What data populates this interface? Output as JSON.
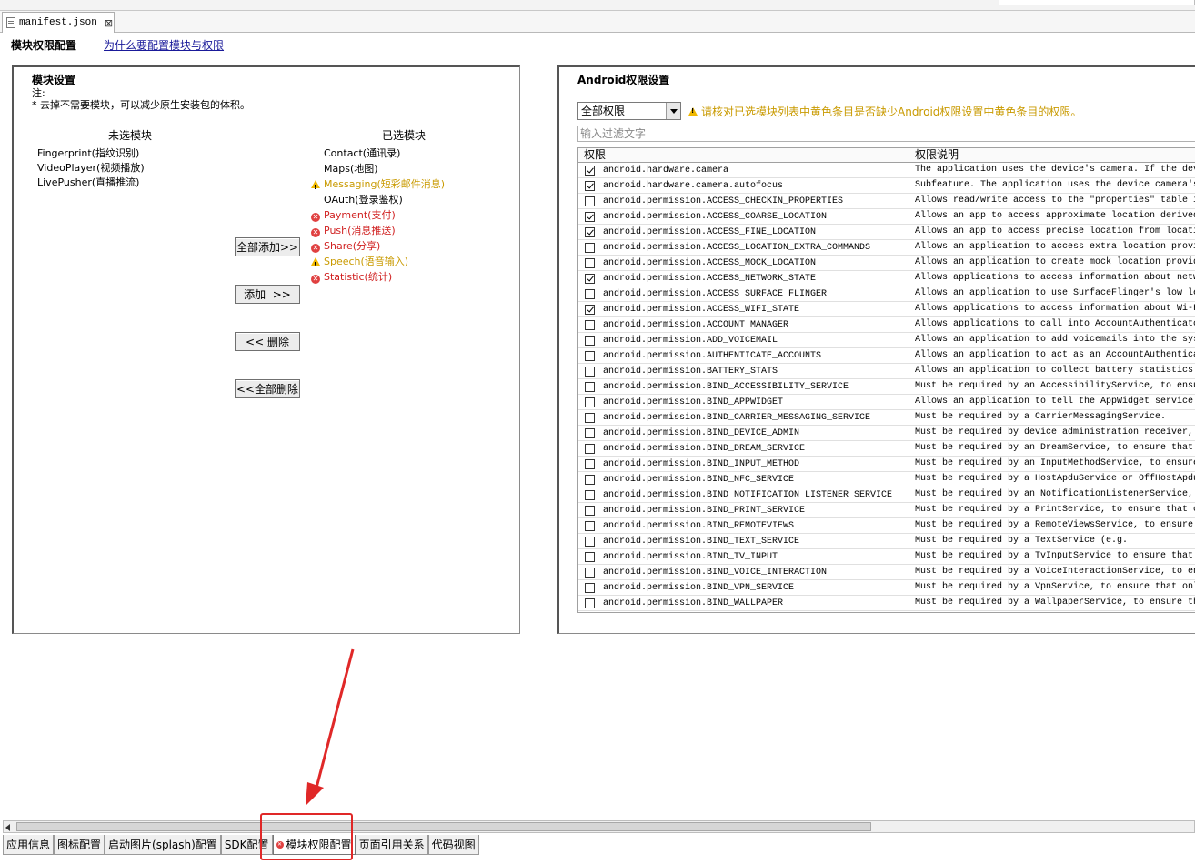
{
  "editor_tab": {
    "filename": "manifest.json",
    "close_label": "⊠"
  },
  "header": {
    "title": "模块权限配置",
    "link": "为什么要配置模块与权限"
  },
  "module_panel": {
    "title": "模块设置",
    "note_line1": "注:",
    "note_line2": "* 去掉不需要模块，可以减少原生安装包的体积。",
    "unselected_header": "未选模块",
    "selected_header": "已选模块",
    "unselected": [
      {
        "name": "Fingerprint(指纹识别)"
      },
      {
        "name": "VideoPlayer(视频播放)"
      },
      {
        "name": "LivePusher(直播推流)"
      }
    ],
    "selected": [
      {
        "name": "Contact(通讯录)",
        "status": "normal"
      },
      {
        "name": "Maps(地图)",
        "status": "normal"
      },
      {
        "name": "Messaging(短彩邮件消息)",
        "status": "warning"
      },
      {
        "name": "OAuth(登录鉴权)",
        "status": "normal"
      },
      {
        "name": "Payment(支付)",
        "status": "error"
      },
      {
        "name": "Push(消息推送)",
        "status": "error"
      },
      {
        "name": "Share(分享)",
        "status": "error"
      },
      {
        "name": "Speech(语音输入)",
        "status": "warning"
      },
      {
        "name": "Statistic(统计)",
        "status": "error"
      }
    ],
    "buttons": {
      "add_all": "全部添加>>",
      "add": "添加  >>",
      "remove": "<< 删除",
      "remove_all": "<<全部删除"
    }
  },
  "permission_panel": {
    "title": "Android权限设置",
    "filter_select": "全部权限",
    "warning": "请核对已选模块列表中黄色条目是否缺少Android权限设置中黄色条目的权限。",
    "filter_placeholder": "输入过滤文字",
    "col_permission": "权限",
    "col_description": "权限说明",
    "rows": [
      {
        "checked": true,
        "perm": "android.hardware.camera",
        "desc": "The application uses the device's camera. If the dev"
      },
      {
        "checked": true,
        "perm": "android.hardware.camera.autofocus",
        "desc": "Subfeature. The application uses the device camera's"
      },
      {
        "checked": false,
        "perm": "android.permission.ACCESS_CHECKIN_PROPERTIES",
        "desc": "Allows read/write access to the \"properties\" table i"
      },
      {
        "checked": true,
        "perm": "android.permission.ACCESS_COARSE_LOCATION",
        "desc": "Allows an app to access approximate location derived"
      },
      {
        "checked": true,
        "perm": "android.permission.ACCESS_FINE_LOCATION",
        "desc": "Allows an app to access precise location from locati"
      },
      {
        "checked": false,
        "perm": "android.permission.ACCESS_LOCATION_EXTRA_COMMANDS",
        "desc": "Allows an application to access extra location provi"
      },
      {
        "checked": false,
        "perm": "android.permission.ACCESS_MOCK_LOCATION",
        "desc": "Allows an application to create mock location provid"
      },
      {
        "checked": true,
        "perm": "android.permission.ACCESS_NETWORK_STATE",
        "desc": "Allows applications to access information about netw"
      },
      {
        "checked": false,
        "perm": "android.permission.ACCESS_SURFACE_FLINGER",
        "desc": "Allows an application to use SurfaceFlinger's low le"
      },
      {
        "checked": true,
        "perm": "android.permission.ACCESS_WIFI_STATE",
        "desc": "Allows applications to access information about Wi-F"
      },
      {
        "checked": false,
        "perm": "android.permission.ACCOUNT_MANAGER",
        "desc": "Allows applications to call into AccountAuthenticato"
      },
      {
        "checked": false,
        "perm": "android.permission.ADD_VOICEMAIL",
        "desc": "Allows an application to add voicemails into the sys"
      },
      {
        "checked": false,
        "perm": "android.permission.AUTHENTICATE_ACCOUNTS",
        "desc": "Allows an application to act as an AccountAuthentica"
      },
      {
        "checked": false,
        "perm": "android.permission.BATTERY_STATS",
        "desc": "Allows an application to collect battery statistics"
      },
      {
        "checked": false,
        "perm": "android.permission.BIND_ACCESSIBILITY_SERVICE",
        "desc": "Must be required by an AccessibilityService, to ensu"
      },
      {
        "checked": false,
        "perm": "android.permission.BIND_APPWIDGET",
        "desc": "Allows an application to tell the AppWidget service"
      },
      {
        "checked": false,
        "perm": "android.permission.BIND_CARRIER_MESSAGING_SERVICE",
        "desc": "Must be required by a CarrierMessagingService."
      },
      {
        "checked": false,
        "perm": "android.permission.BIND_DEVICE_ADMIN",
        "desc": "Must be required by device administration receiver,"
      },
      {
        "checked": false,
        "perm": "android.permission.BIND_DREAM_SERVICE",
        "desc": "Must be required by an DreamService, to ensure that"
      },
      {
        "checked": false,
        "perm": "android.permission.BIND_INPUT_METHOD",
        "desc": "Must be required by an InputMethodService, to ensure"
      },
      {
        "checked": false,
        "perm": "android.permission.BIND_NFC_SERVICE",
        "desc": "Must be required by a HostApduService or OffHostApdu"
      },
      {
        "checked": false,
        "perm": "android.permission.BIND_NOTIFICATION_LISTENER_SERVICE",
        "desc": "Must be required by an NotificationListenerService,"
      },
      {
        "checked": false,
        "perm": "android.permission.BIND_PRINT_SERVICE",
        "desc": "Must be required by a PrintService, to ensure that o"
      },
      {
        "checked": false,
        "perm": "android.permission.BIND_REMOTEVIEWS",
        "desc": "Must be required by a RemoteViewsService, to ensure"
      },
      {
        "checked": false,
        "perm": "android.permission.BIND_TEXT_SERVICE",
        "desc": "Must be required by a TextService (e.g."
      },
      {
        "checked": false,
        "perm": "android.permission.BIND_TV_INPUT",
        "desc": "Must be required by a TvInputService to ensure that"
      },
      {
        "checked": false,
        "perm": "android.permission.BIND_VOICE_INTERACTION",
        "desc": "Must be required by a VoiceInteractionService, to en"
      },
      {
        "checked": false,
        "perm": "android.permission.BIND_VPN_SERVICE",
        "desc": "Must be required by a VpnService, to ensure that onl"
      },
      {
        "checked": false,
        "perm": "android.permission.BIND_WALLPAPER",
        "desc": "Must be required by a WallpaperService, to ensure th"
      }
    ]
  },
  "bottom_tabs": [
    {
      "label": "应用信息",
      "active": false,
      "error": false
    },
    {
      "label": "图标配置",
      "active": false,
      "error": false
    },
    {
      "label": "启动图片(splash)配置",
      "active": false,
      "error": false
    },
    {
      "label": "SDK配置",
      "active": false,
      "error": false
    },
    {
      "label": "模块权限配置",
      "active": true,
      "error": true
    },
    {
      "label": "页面引用关系",
      "active": false,
      "error": false
    },
    {
      "label": "代码视图",
      "active": false,
      "error": false
    }
  ],
  "colors": {
    "warning": "#c99a00",
    "error": "#d02020",
    "annotation": "#e02828",
    "link": "#1a1a9a"
  }
}
